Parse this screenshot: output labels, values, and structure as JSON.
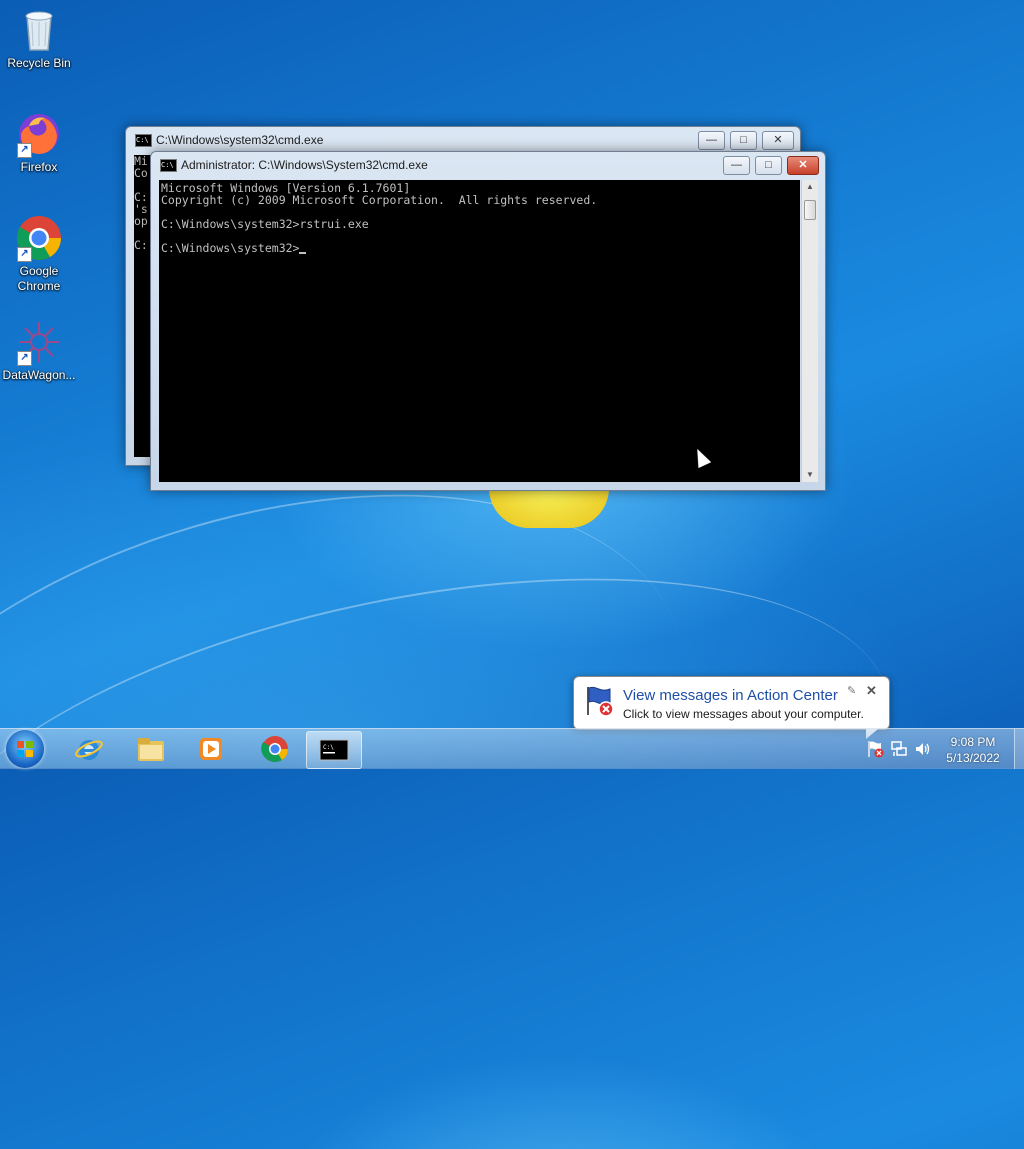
{
  "desktop": {
    "icons": [
      {
        "label": "Recycle Bin",
        "icon": "recycle-bin-icon"
      },
      {
        "label": "Firefox",
        "icon": "firefox-icon"
      },
      {
        "label": "Google Chrome",
        "icon": "chrome-icon"
      },
      {
        "label": "DataWagon...",
        "icon": "datawagon-icon"
      }
    ]
  },
  "back_window": {
    "title": "C:\\Windows\\system32\\cmd.exe",
    "console_text": "Mi\nCo\n\nC:\n's\nop\n\nC:"
  },
  "front_window": {
    "title": "Administrator: C:\\Windows\\System32\\cmd.exe",
    "console_lines": [
      "Microsoft Windows [Version 6.1.7601]",
      "Copyright (c) 2009 Microsoft Corporation.  All rights reserved.",
      "",
      "C:\\Windows\\system32>rstrui.exe",
      "",
      "C:\\Windows\\system32>"
    ],
    "controls": {
      "minimize": "—",
      "maximize": "□",
      "close": "✕"
    }
  },
  "notification": {
    "title": "View messages in Action Center",
    "text": "Click to view messages about your computer.",
    "pin_glyph": "✎",
    "close_glyph": "✕"
  },
  "taskbar": {
    "pinned": [
      "internet-explorer-icon",
      "file-explorer-icon",
      "media-player-icon",
      "chrome-icon",
      "cmd-icon"
    ],
    "clock_time": "9:08 PM",
    "clock_date": "5/13/2022"
  },
  "colors": {
    "desktop_blue": "#1479d0",
    "console_bg": "#000000",
    "console_fg": "#c0c0c0",
    "notification_title": "#1f4fa6",
    "close_button": "#c7412a"
  }
}
